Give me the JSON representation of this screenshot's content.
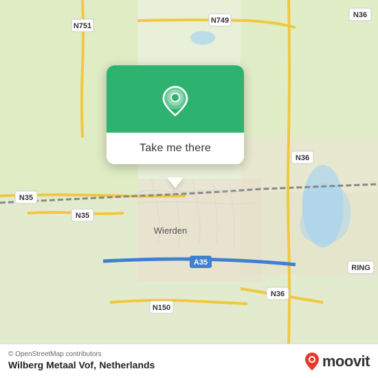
{
  "map": {
    "background_color": "#e8f0d8",
    "center_lat": 52.35,
    "center_lon": 6.61
  },
  "popup": {
    "button_label": "Take me there",
    "green_color": "#2db36f"
  },
  "bottom_bar": {
    "copyright": "© OpenStreetMap contributors",
    "place_name": "Wilberg Metaal Vof,",
    "country": "Netherlands",
    "logo_text": "moovit"
  },
  "road_labels": {
    "n36_top_right": "N36",
    "n751": "N751",
    "n749": "N749",
    "n36_mid": "N36",
    "n35_left": "N35",
    "n35_bottom": "N35",
    "n36_bottom": "N36",
    "a35": "A35",
    "n150": "N150",
    "ring": "RING",
    "wierden": "Wierden"
  }
}
